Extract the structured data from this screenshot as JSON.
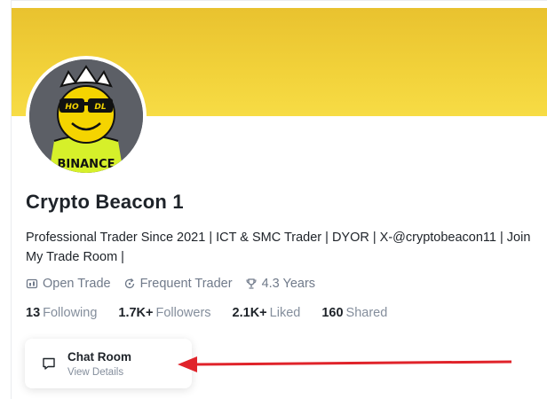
{
  "profile": {
    "name": "Crypto Beacon 1",
    "bio": "Professional Trader Since 2021 | ICT & SMC Trader | DYOR | X-@cryptobeacon11 | Join My Trade Room |",
    "avatar_text": {
      "glasses_left": "HO",
      "glasses_right": "DL",
      "shirt": "BINANCE"
    }
  },
  "tags": [
    {
      "icon": "open-trade-icon",
      "label": "Open Trade"
    },
    {
      "icon": "frequent-trader-icon",
      "label": "Frequent Trader"
    },
    {
      "icon": "trophy-icon",
      "label": "4.3 Years"
    }
  ],
  "stats": [
    {
      "value": "13",
      "label": "Following"
    },
    {
      "value": "1.7K+",
      "label": "Followers"
    },
    {
      "value": "2.1K+",
      "label": "Liked"
    },
    {
      "value": "160",
      "label": "Shared"
    }
  ],
  "chat_room": {
    "title": "Chat Room",
    "subtitle": "View Details",
    "icon": "chat-bubble-icon"
  },
  "colors": {
    "banner": "#f0cf38",
    "annotation_arrow": "#e0232a",
    "text_primary": "#1e2329",
    "text_secondary": "#848e9c"
  }
}
